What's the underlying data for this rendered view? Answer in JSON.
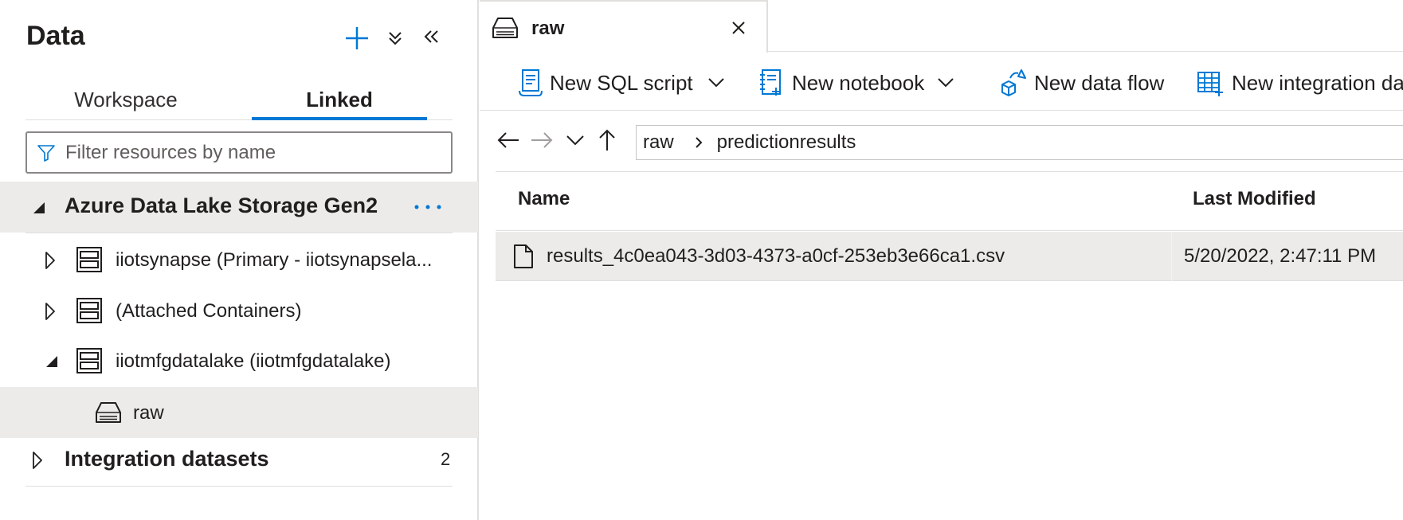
{
  "left_panel": {
    "title": "Data",
    "tabs": [
      {
        "label": "Workspace",
        "active": false
      },
      {
        "label": "Linked",
        "active": true
      }
    ],
    "filter": {
      "placeholder": "Filter resources by name",
      "value": ""
    },
    "group_adls": {
      "label": "Azure Data Lake Storage Gen2",
      "expanded": true
    },
    "tree": [
      {
        "label": "iiotsynapse (Primary - iiotsynapsela...",
        "expanded": false
      },
      {
        "label": "(Attached Containers)",
        "expanded": false
      },
      {
        "label": "iiotmfgdatalake (iiotmfgdatalake)",
        "expanded": true
      }
    ],
    "container": {
      "label": "raw",
      "selected": true
    },
    "group_integration": {
      "label": "Integration datasets",
      "count": "2",
      "expanded": false
    }
  },
  "right_panel": {
    "doc_tab": {
      "label": "raw"
    },
    "toolbar": {
      "new_sql_script": "New SQL script",
      "new_notebook": "New notebook",
      "new_data_flow": "New data flow",
      "new_integration_dataset": "New integration da"
    },
    "breadcrumb": [
      "raw",
      "predictionresults"
    ],
    "columns": {
      "name": "Name",
      "last_modified": "Last Modified"
    },
    "files": [
      {
        "name": "results_4c0ea043-3d03-4373-a0cf-253eb3e66ca1.csv",
        "last_modified": "5/20/2022, 2:47:11 PM"
      }
    ]
  },
  "colors": {
    "accent": "#0078d4",
    "selected_row": "#edebe9",
    "divider": "#e1dfdd"
  }
}
